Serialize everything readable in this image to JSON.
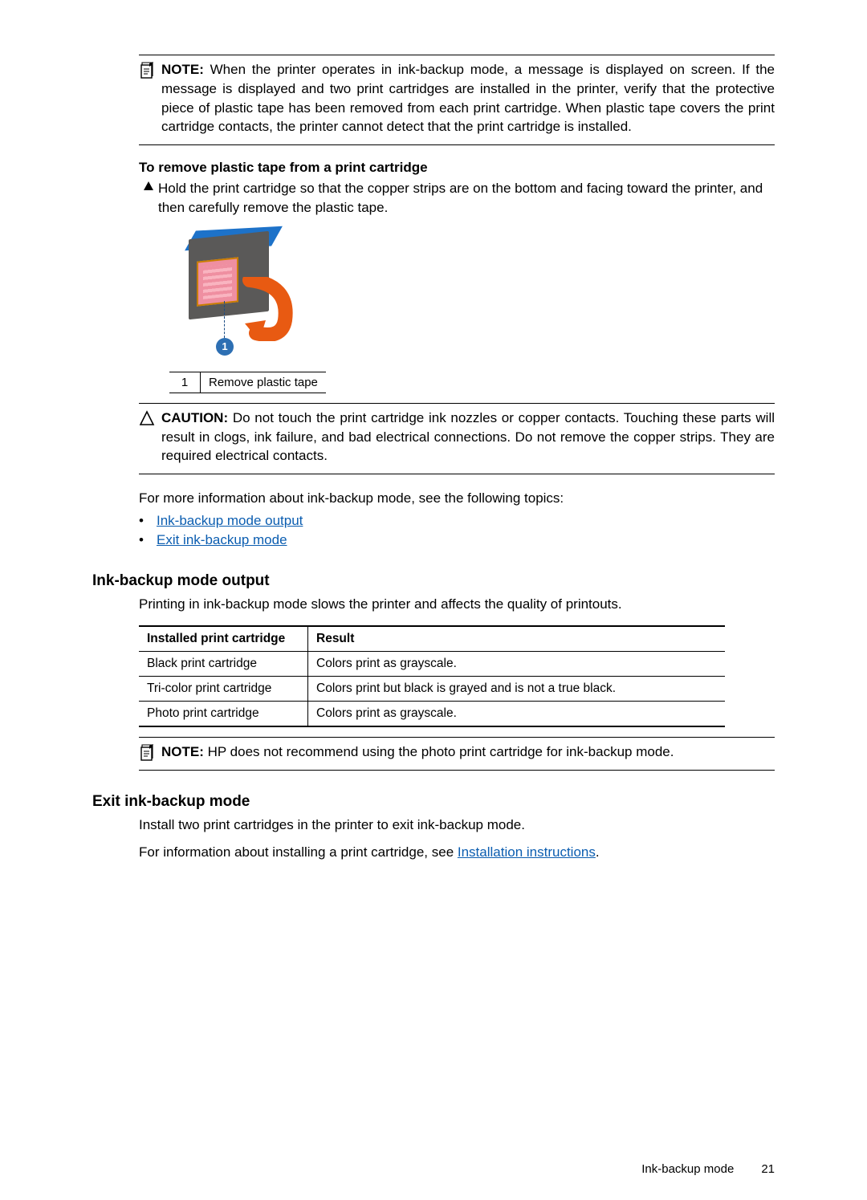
{
  "note1": {
    "label": "NOTE:",
    "text": "When the printer operates in ink-backup mode, a message is displayed on screen. If the message is displayed and two print cartridges are installed in the printer, verify that the protective piece of plastic tape has been removed from each print cartridge. When plastic tape covers the print cartridge contacts, the printer cannot detect that the print cartridge is installed."
  },
  "remove_tape": {
    "heading": "To remove plastic tape from a print cartridge",
    "step": "Hold the print cartridge so that the copper strips are on the bottom and facing toward the printer, and then carefully remove the plastic tape."
  },
  "legend": {
    "num": "1",
    "text": "Remove plastic tape"
  },
  "caution1": {
    "label": "CAUTION:",
    "text": "Do not touch the print cartridge ink nozzles or copper contacts. Touching these parts will result in clogs, ink failure, and bad electrical connections. Do not remove the copper strips. They are required electrical contacts."
  },
  "more_info": "For more information about ink-backup mode, see the following topics:",
  "links": {
    "output": "Ink-backup mode output",
    "exit": "Exit ink-backup mode"
  },
  "output_section": {
    "heading": "Ink-backup mode output",
    "para": "Printing in ink-backup mode slows the printer and affects the quality of printouts.",
    "headers": {
      "cart": "Installed print cartridge",
      "result": "Result"
    },
    "rows": [
      {
        "cart": "Black print cartridge",
        "result": "Colors print as grayscale."
      },
      {
        "cart": "Tri-color print cartridge",
        "result": "Colors print but black is grayed and is not a true black."
      },
      {
        "cart": "Photo print cartridge",
        "result": "Colors print as grayscale."
      }
    ]
  },
  "note2": {
    "label": "NOTE:",
    "text": "HP does not recommend using the photo print cartridge for ink-backup mode."
  },
  "exit_section": {
    "heading": "Exit ink-backup mode",
    "para1": "Install two print cartridges in the printer to exit ink-backup mode.",
    "para2_pre": "For information about installing a print cartridge, see ",
    "para2_link": "Installation instructions",
    "para2_post": "."
  },
  "footer": {
    "section": "Ink-backup mode",
    "page": "21"
  }
}
